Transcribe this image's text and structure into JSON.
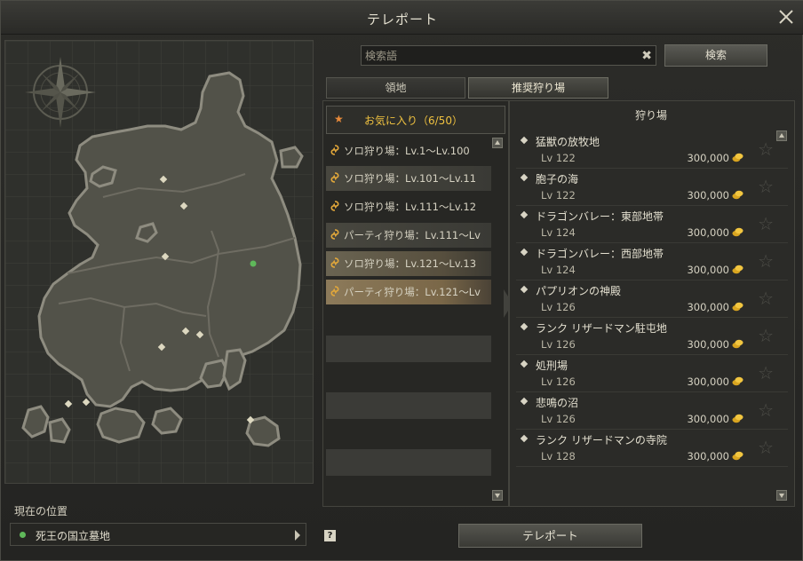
{
  "window": {
    "title": "テレポート"
  },
  "search": {
    "placeholder": "検索語",
    "button_label": "検索"
  },
  "tabs": [
    {
      "label": "領地",
      "active": false
    },
    {
      "label": "推奨狩り場",
      "active": true
    }
  ],
  "favorites": {
    "label": "お気に入り（6/50）"
  },
  "categories": [
    "ソロ狩り場：Lv.1～Lv.100",
    "ソロ狩り場：Lv.101～Lv.11",
    "ソロ狩り場：Lv.111～Lv.12",
    "パーティ狩り場：Lv.111～Lv",
    "ソロ狩り場：Lv.121～Lv.13",
    "パーティ狩り場：Lv.121～Lv"
  ],
  "hunting_list": {
    "header": "狩り場",
    "items": [
      {
        "name": "猛獣の放牧地",
        "level": "Lv 122",
        "cost": "300,000"
      },
      {
        "name": "胞子の海",
        "level": "Lv 122",
        "cost": "300,000"
      },
      {
        "name": "ドラゴンバレー：東部地帯",
        "level": "Lv 124",
        "cost": "300,000"
      },
      {
        "name": "ドラゴンバレー：西部地帯",
        "level": "Lv 124",
        "cost": "300,000"
      },
      {
        "name": "パプリオンの神殿",
        "level": "Lv 126",
        "cost": "300,000"
      },
      {
        "name": "ランク リザードマン駐屯地",
        "level": "Lv 126",
        "cost": "300,000"
      },
      {
        "name": "処刑場",
        "level": "Lv 126",
        "cost": "300,000"
      },
      {
        "name": "悲鳴の沼",
        "level": "Lv 126",
        "cost": "300,000"
      },
      {
        "name": "ランク リザードマンの寺院",
        "level": "Lv 128",
        "cost": "300,000"
      }
    ]
  },
  "current_location": {
    "label": "現在の位置",
    "value": "死王の国立墓地"
  },
  "footer": {
    "help_label": "?",
    "teleport_label": "テレポート"
  },
  "colors": {
    "accent": "#f0c240",
    "favorite_star": "#e88a3a",
    "location_dot": "#5fb85a"
  },
  "icons": {
    "close": "close-icon",
    "compass": "compass-icon",
    "category": "swirl-icon",
    "coin": "adena-coin-icon",
    "favorite": "star-icon",
    "help": "help-icon"
  }
}
